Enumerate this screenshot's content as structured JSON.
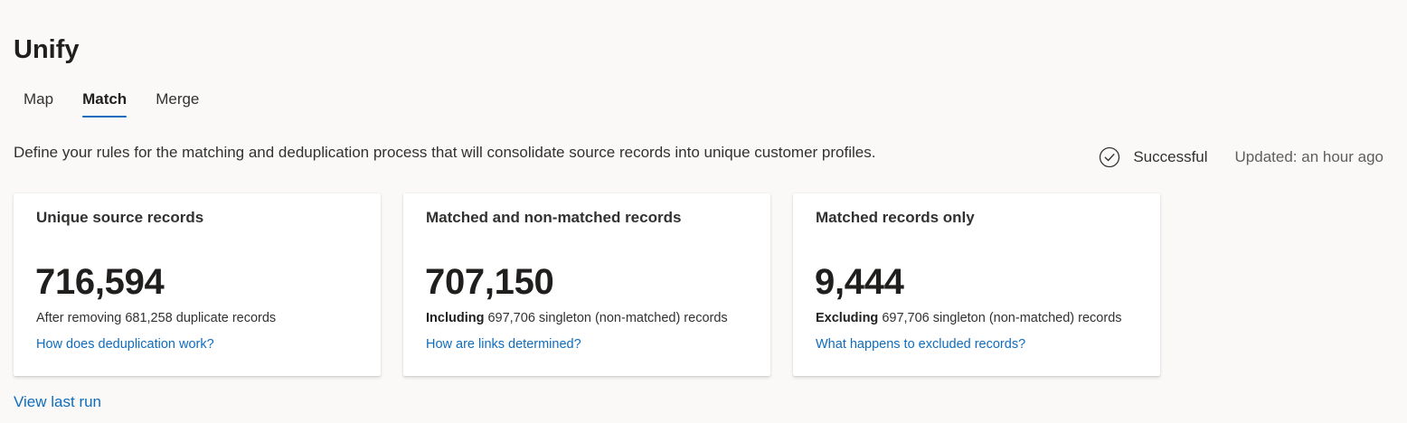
{
  "header": {
    "title": "Unify"
  },
  "tabs": [
    {
      "label": "Map",
      "active": false
    },
    {
      "label": "Match",
      "active": true
    },
    {
      "label": "Merge",
      "active": false
    }
  ],
  "description": "Define your rules for the matching and deduplication process that will consolidate source records into unique customer profiles.",
  "status": {
    "icon": "check-circle-icon",
    "text": "Successful",
    "updated": "Updated: an hour ago"
  },
  "cards": [
    {
      "title": "Unique source records",
      "value": "716,594",
      "sub_bold": "",
      "sub_text": "After removing 681,258 duplicate records",
      "link": "How does deduplication work?"
    },
    {
      "title": "Matched and non-matched records",
      "value": "707,150",
      "sub_bold": "Including",
      "sub_text": " 697,706 singleton (non-matched) records",
      "link": "How are links determined?"
    },
    {
      "title": "Matched records only",
      "value": "9,444",
      "sub_bold": "Excluding",
      "sub_text": " 697,706 singleton (non-matched) records",
      "link": "What happens to excluded records?"
    }
  ],
  "footer": {
    "view_last_run": "View last run"
  },
  "colors": {
    "accent": "#0f6cbd",
    "background": "#faf9f8",
    "card": "#ffffff",
    "text": "#323130"
  }
}
